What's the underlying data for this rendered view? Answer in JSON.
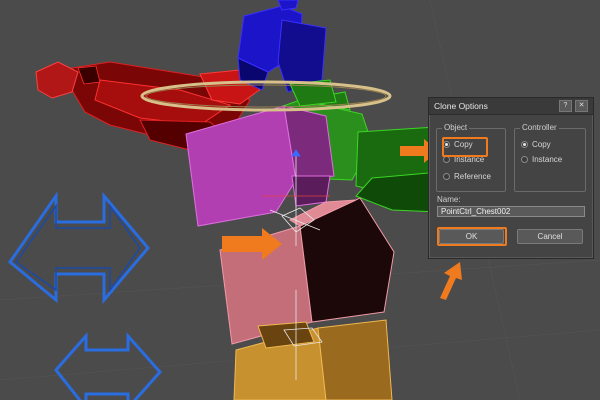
{
  "dialog": {
    "title": "Clone Options",
    "help_glyph": "?",
    "close_glyph": "✕",
    "object_group": {
      "label": "Object",
      "options": [
        {
          "label": "Copy",
          "selected": true
        },
        {
          "label": "Instance",
          "selected": false
        },
        {
          "label": "Reference",
          "selected": false
        }
      ]
    },
    "controller_group": {
      "label": "Controller",
      "options": [
        {
          "label": "Copy",
          "selected": true
        },
        {
          "label": "Instance",
          "selected": false
        }
      ]
    },
    "name_label": "Name:",
    "name_value": "PointCtrl_Chest002",
    "ok_label": "OK",
    "cancel_label": "Cancel"
  },
  "icons": {
    "orange_arrow": "orange-arrow-icon",
    "blue_double_arrow": "double-arrow-icon"
  },
  "colors": {
    "annotation_orange": "#f07a1e",
    "viewport_bg": "#4b4b4b",
    "rig_blue": "#1c14c9",
    "rig_green": "#1f7a14",
    "rig_magenta": "#b23fb2",
    "rig_pink": "#c46e7a",
    "rig_red": "#c81414",
    "rig_orange": "#c8912f",
    "controller_blue": "#2a6de0",
    "ring_tan": "#d8c08a"
  }
}
